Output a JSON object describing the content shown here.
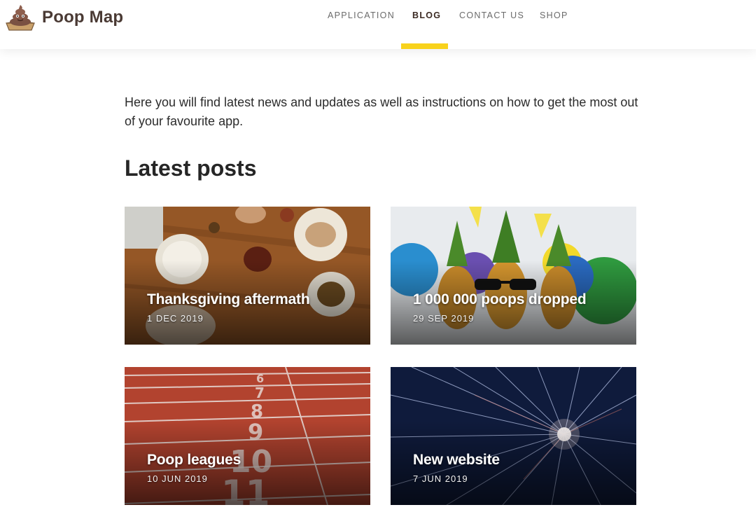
{
  "brand": {
    "name": "Poop Map",
    "logo_icon": "poop-icon"
  },
  "nav": {
    "items": [
      {
        "label": "APPLICATION",
        "active": false
      },
      {
        "label": "BLOG",
        "active": true
      },
      {
        "label": "CONTACT US",
        "active": false
      },
      {
        "label": "SHOP",
        "active": false
      }
    ],
    "accent_color": "#f8d21c"
  },
  "main": {
    "intro": "Here you will find latest news and updates as well as instructions on how to get the most out of your favourite app.",
    "section_title": "Latest posts",
    "posts": [
      {
        "title": "Thanksgiving aftermath",
        "date": "1 DEC 2019",
        "image": "thanksgiving-table-photo"
      },
      {
        "title": "1 000 000 poops dropped",
        "date": "29 SEP 2019",
        "image": "party-pineapples-photo"
      },
      {
        "title": "Poop leagues",
        "date": "10 JUN 2019",
        "image": "running-track-photo"
      },
      {
        "title": "New website",
        "date": "7 JUN 2019",
        "image": "fireworks-photo"
      }
    ]
  }
}
